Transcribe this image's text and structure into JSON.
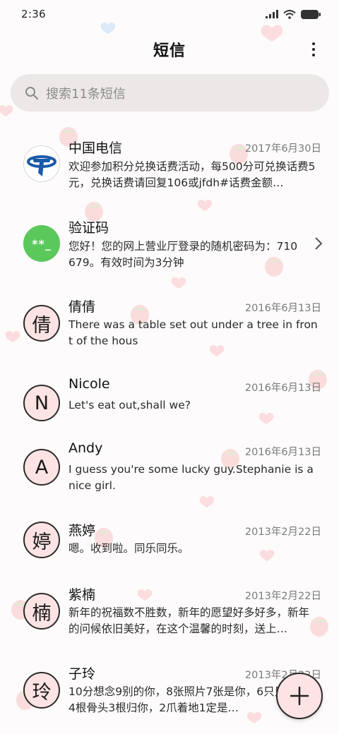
{
  "status_bar": {
    "time": "2:36"
  },
  "header": {
    "title": "短信"
  },
  "search": {
    "placeholder": "搜索11条短信"
  },
  "conversations": [
    {
      "name": "中国电信",
      "date": "2017年6月30日",
      "preview": "欢迎参加积分兑换话费活动，每500分可兑换话费5元，兑换话费请回复106或jfdh#话费金额…",
      "avatar_type": "logo",
      "avatar": ""
    },
    {
      "name": "验证码",
      "date": "",
      "preview": "您好！您的网上营业厅登录的随机密码为：710679。有效时间为3分钟",
      "avatar_type": "code",
      "avatar": "**_"
    },
    {
      "name": "倩倩",
      "date": "2016年6月13日",
      "preview": "There was a table set out under a tree in front of the hous",
      "avatar_type": "letter",
      "avatar": "倩"
    },
    {
      "name": "Nicole",
      "date": "2016年6月13日",
      "preview": "Let's eat out,shall we?",
      "avatar_type": "letter",
      "avatar": "N"
    },
    {
      "name": "Andy",
      "date": "2016年6月13日",
      "preview": "I guess you're some lucky guy.Stephanie is a nice girl.",
      "avatar_type": "letter",
      "avatar": "A"
    },
    {
      "name": "燕婷",
      "date": "2013年2月22日",
      "preview": "嗯。收到啦。同乐同乐。",
      "avatar_type": "letter",
      "avatar": "婷"
    },
    {
      "name": "紫楠",
      "date": "2013年2月22日",
      "preview": "新年的祝福数不胜数，新年的愿望好多好多，新年的问候依旧美好，在这个温馨的时刻，送上…",
      "avatar_type": "letter",
      "avatar": "楠"
    },
    {
      "name": "子玲",
      "date": "2013年2月22日",
      "preview": "10分想念9别的你，8张照片7张是你，6只只像你，4根骨头3根归你，2爪着地1定是…",
      "avatar_type": "letter",
      "avatar": "玲"
    }
  ],
  "colors": {
    "avatar_fill": "#fde3e3",
    "code_green": "#5ac85a",
    "telecom_blue": "#1a5aa8",
    "search_bg": "#ece8e8"
  },
  "icons": {
    "more": "more-vertical-icon",
    "search": "search-icon",
    "compose": "plus-icon",
    "chevron": "chevron-right-icon"
  }
}
